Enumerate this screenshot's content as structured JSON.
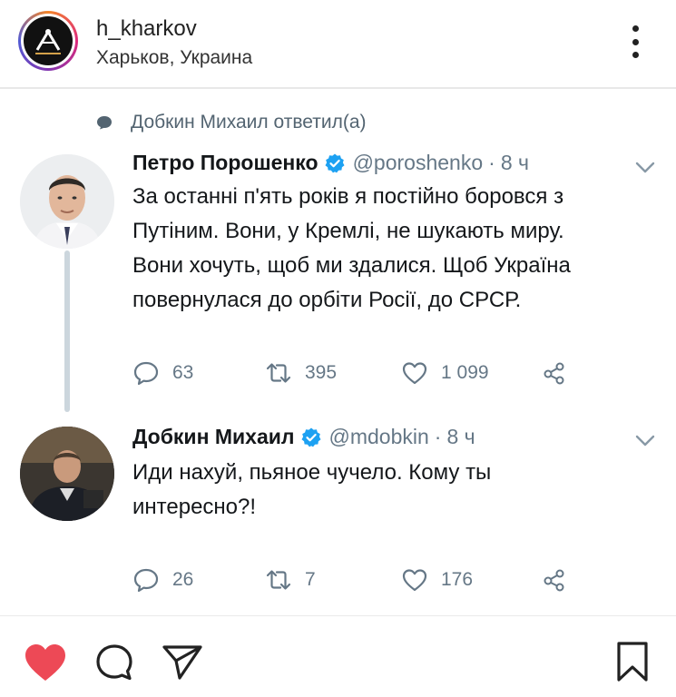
{
  "post": {
    "username": "h_kharkov",
    "location": "Харьков, Украина",
    "avatar_icon": "h-kharkov-logo-icon"
  },
  "tweet_context": {
    "replied_text": "Добкин Михаил ответил(а)"
  },
  "tweets": [
    {
      "name": "Петро Порошенко",
      "handle": "@poroshenko",
      "separator": "·",
      "time": "8 ч",
      "verified": true,
      "text_lines": [
        "За останні п'ять років я постійно боровся з",
        "Путіним. Вони, у Кремлі, не шукають миру.",
        "Вони хочуть, щоб ми здалися. Щоб Україна",
        "повернулася до орбіти Росії, до СРСР."
      ],
      "replies": "63",
      "retweets": "395",
      "likes": "1 099"
    },
    {
      "name": "Добкин Михаил",
      "handle": "@mdobkin",
      "separator": "·",
      "time": "8 ч",
      "verified": true,
      "text_lines": [
        "Иди нахуй, пьяное чучело. Кому ты",
        "интересно?!"
      ],
      "replies": "26",
      "retweets": "7",
      "likes": "176"
    }
  ],
  "colors": {
    "verified": "#1da1f2",
    "muted": "#657786",
    "like_active": "#ed4956",
    "thread_line": "#ccd6dd"
  }
}
